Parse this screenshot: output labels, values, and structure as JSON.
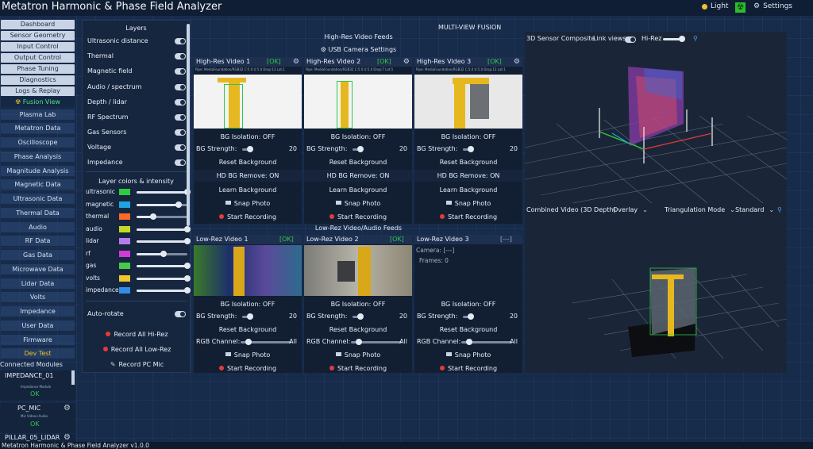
{
  "app": {
    "title": "Metatron Harmonic & Phase Field Analyzer",
    "theme_label": "Light",
    "settings_label": "Settings",
    "status": "Metatron Harmonic & Phase Field Analyzer v1.0.0"
  },
  "sidebar": {
    "buttons": [
      "Dashboard",
      "Sensor Geometry",
      "Input Control",
      "Output Control",
      "Phase Tuning",
      "Diagnostics",
      "Logs & Replay"
    ],
    "active": "Fusion View",
    "sections": [
      "Plasma Lab",
      "Metatron Data",
      "Oscilloscope",
      "Phase Analysis",
      "Magnitude Analysis",
      "Magnetic Data",
      "Ultrasonic Data",
      "Thermal Data",
      "Audio",
      "RF Data",
      "Gas Data",
      "Microwave Data",
      "Lidar Data",
      "Volts",
      "Impedance",
      "User Data",
      "Firmware"
    ],
    "dev": "Dev Test",
    "connected_label": "Connected Modules",
    "modules": [
      {
        "name": "IMPEDANCE_01",
        "sub": "Impedance Module",
        "status": "OK"
      },
      {
        "name": "PC_MIC",
        "sub": "Mic Video+Audio",
        "status": "OK"
      },
      {
        "name": "PILLAR_05_LIDAR",
        "sub": "",
        "status": ""
      }
    ]
  },
  "layers": {
    "title": "Layers",
    "items": [
      "Ultrasonic distance",
      "Thermal",
      "Magnetic field",
      "Audio / spectrum",
      "Depth / lidar",
      "RF Spectrum",
      "Gas Sensors",
      "Voltage",
      "Impedance"
    ],
    "colors_title": "Layer colors & intensity",
    "colors": [
      {
        "name": "ultrasonic",
        "color": "#2ecc40",
        "level": 1.0
      },
      {
        "name": "magnetic",
        "color": "#1fa3e0",
        "level": 0.83
      },
      {
        "name": "thermal",
        "color": "#ff6a2a",
        "level": 0.33
      },
      {
        "name": "audio",
        "color": "#c7d928",
        "level": 1.0
      },
      {
        "name": "lidar",
        "color": "#b57cf0",
        "level": 1.0
      },
      {
        "name": "rf",
        "color": "#d23ad8",
        "level": 0.53
      },
      {
        "name": "gas",
        "color": "#48c94a",
        "level": 1.0
      },
      {
        "name": "volts",
        "color": "#f1c72c",
        "level": 1.0
      },
      {
        "name": "impedance",
        "color": "#2f8de8",
        "level": 1.0
      }
    ],
    "auto_rotate": "Auto-rotate",
    "record_hi": "Record All Hi-Rez",
    "record_low": "Record All Low-Rez",
    "record_pc": "Record PC Mic"
  },
  "center": {
    "title": "MULTI-VIEW FUSION",
    "hires_title": "High-Res Video Feeds",
    "usb_label": "USB Camera Settings",
    "lowres_title": "Low-Rez Video/Audio Feeds",
    "hires": [
      {
        "title": "High-Res Video 1",
        "status": "[OK]",
        "pipe": "Pipe: MediaFoundation/RGB32  C:5.0 U:5.0  Drop:13  Lat:1"
      },
      {
        "title": "High-Res Video 2",
        "status": "[OK]",
        "pipe": "Pipe: MediaFoundation/RGB32  C:5.0 U:5.0  Drop:7  Lat:1"
      },
      {
        "title": "High-Res Video 3",
        "status": "[OK]",
        "pipe": "Pipe: MediaFoundation/RGB32  C:5.0 U:5.0  Drop:13  Lat:1"
      }
    ],
    "lowres": [
      {
        "title": "Low-Rez Video 1",
        "status": "[OK]"
      },
      {
        "title": "Low-Rez Video 2",
        "status": "[OK]"
      },
      {
        "title": "Low-Rez Video 3",
        "status": "[---]",
        "camera": "Camera: [---]",
        "frames": "Frames: 0"
      }
    ],
    "bg_isolation": "BG Isolation: OFF",
    "bg_strength": "BG Strength:",
    "bg_strength_val": "20",
    "reset_bg": "Reset Background",
    "hd_bg": "HD BG Remove: ON",
    "learn_bg": "Learn Background",
    "snap": "Snap Photo",
    "start_rec": "Start Recording",
    "rgb": "RGB Channel:",
    "rgb_val": "All"
  },
  "right": {
    "composite_title": "3D Sensor Composite",
    "link_views": "Link views",
    "hi_rez": "Hi-Rez",
    "combined_title": "Combined Video (3D Depth)",
    "overlay": "Overlay",
    "triangulation": "Triangulation Mode",
    "standard": "Standard"
  }
}
